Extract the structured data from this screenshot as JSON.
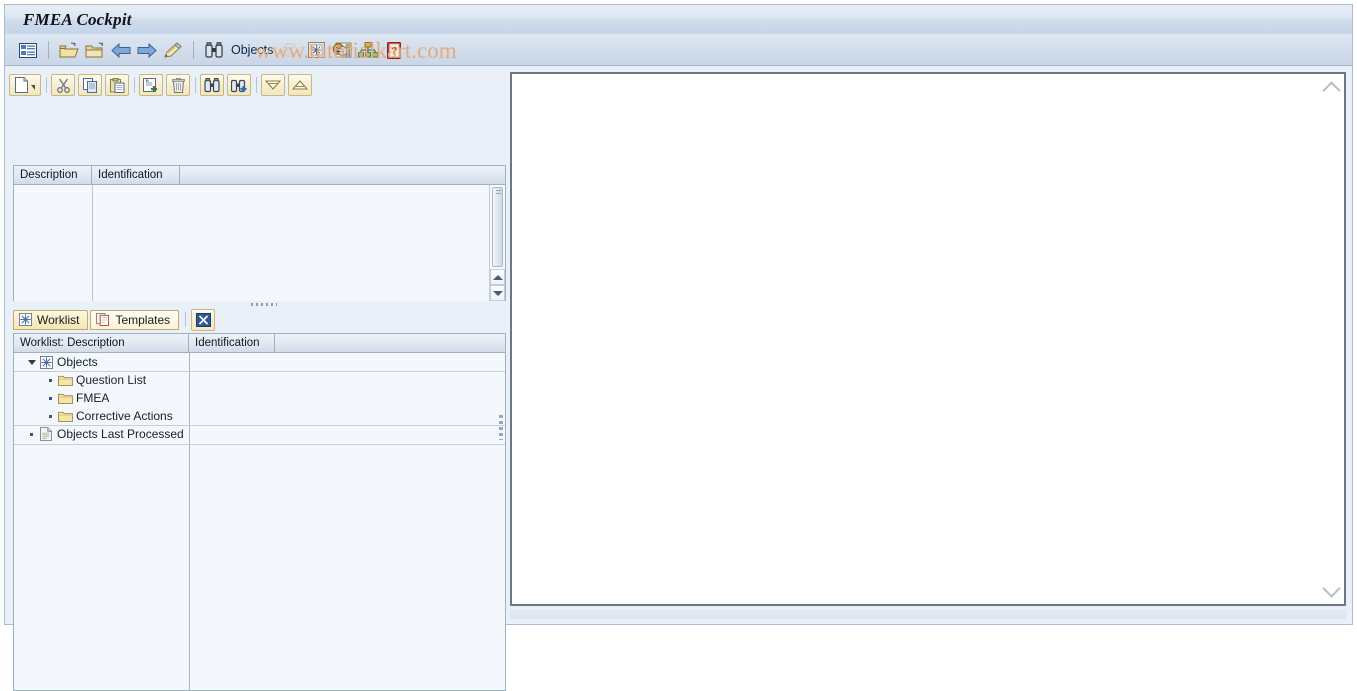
{
  "window": {
    "title": "FMEA Cockpit"
  },
  "watermark": {
    "text": "www.tutorialkart.com"
  },
  "main_toolbar": {
    "objects_label": "Objects",
    "items": [
      {
        "name": "menu-list-icon",
        "label": ""
      },
      {
        "name": "open-folder-icon",
        "label": ""
      },
      {
        "name": "closed-folder-icon",
        "label": ""
      },
      {
        "name": "back-arrow-icon",
        "label": ""
      },
      {
        "name": "forward-arrow-icon",
        "label": ""
      },
      {
        "name": "pencil-edit-icon",
        "label": ""
      },
      {
        "name": "binoculars-icon",
        "label": "Objects"
      },
      {
        "name": "copyright-icon",
        "label": ""
      },
      {
        "name": "worklist-icon",
        "label": ""
      },
      {
        "name": "theater-masks-icon",
        "label": ""
      },
      {
        "name": "hierarchy-icon",
        "label": ""
      },
      {
        "name": "help-book-icon",
        "label": ""
      }
    ]
  },
  "list_toolbar": {
    "buttons": [
      {
        "name": "new-object-button",
        "tooltip": "Create"
      },
      {
        "name": "cut-button",
        "tooltip": "Cut"
      },
      {
        "name": "copy-button",
        "tooltip": "Copy"
      },
      {
        "name": "paste-button",
        "tooltip": "Paste"
      },
      {
        "name": "create-with-template-button",
        "tooltip": "Create with Template"
      },
      {
        "name": "delete-button",
        "tooltip": "Delete"
      },
      {
        "name": "find-button",
        "tooltip": "Find"
      },
      {
        "name": "find-next-button",
        "tooltip": "Find Next"
      },
      {
        "name": "expand-all-button",
        "tooltip": "Expand"
      },
      {
        "name": "collapse-all-button",
        "tooltip": "Collapse"
      }
    ]
  },
  "upper_list": {
    "columns": [
      "Description",
      "Identification",
      ""
    ],
    "rows": []
  },
  "tabs": [
    {
      "label": "Worklist",
      "icon": "worklist-icon",
      "active": true
    },
    {
      "label": "Templates",
      "icon": "templates-icon",
      "active": false
    }
  ],
  "tab_actions": {
    "close_label": "",
    "close_icon": "cancel-x-icon"
  },
  "worklist": {
    "columns": [
      "Worklist: Description",
      "Identification",
      ""
    ],
    "tree": [
      {
        "label": "Objects",
        "icon": "worklist-node-icon",
        "toggle": "caret-down",
        "level": 0
      },
      {
        "label": "Question List",
        "icon": "folder-icon",
        "toggle": "dot",
        "level": 1
      },
      {
        "label": "FMEA",
        "icon": "folder-icon",
        "toggle": "dot",
        "level": 1
      },
      {
        "label": "Corrective Actions",
        "icon": "folder-icon",
        "toggle": "dot",
        "level": 1
      },
      {
        "label": "Objects Last Processed",
        "icon": "document-icon",
        "toggle": "dot",
        "level": 0
      }
    ]
  },
  "content_panel": {
    "body_text": "",
    "scroll_up_icon": "chevron-up-icon",
    "scroll_down_icon": "chevron-down-icon"
  },
  "colors": {
    "title_bar": "#cfdcec",
    "toolbar": "#d2ddec",
    "button_yellow": "#f6eed0",
    "panel_bg": "#eaf0f7",
    "grid_bg": "#f4f8fc",
    "watermark": "#e8a771",
    "border": "#9fb0c2"
  }
}
